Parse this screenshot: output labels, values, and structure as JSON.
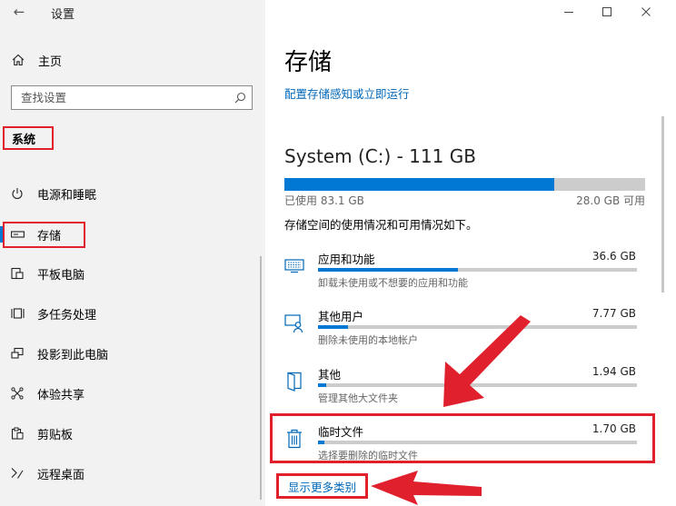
{
  "window": {
    "app_title": "设置",
    "back_icon": "back-arrow-icon",
    "controls": [
      "minimize-icon",
      "maximize-icon",
      "close-icon"
    ]
  },
  "sidebar": {
    "home": {
      "label": "主页",
      "icon": "home-icon"
    },
    "search": {
      "placeholder": "查找设置",
      "icon": "search-icon"
    },
    "section_title": "系统",
    "items": [
      {
        "label": "电源和睡眠",
        "icon": "power-icon",
        "selected": false
      },
      {
        "label": "存储",
        "icon": "storage-icon",
        "selected": true
      },
      {
        "label": "平板电脑",
        "icon": "tablet-icon",
        "selected": false
      },
      {
        "label": "多任务处理",
        "icon": "multitasking-icon",
        "selected": false
      },
      {
        "label": "投影到此电脑",
        "icon": "project-icon",
        "selected": false
      },
      {
        "label": "体验共享",
        "icon": "shared-experience-icon",
        "selected": false
      },
      {
        "label": "剪贴板",
        "icon": "clipboard-icon",
        "selected": false
      },
      {
        "label": "远程桌面",
        "icon": "remote-desktop-icon",
        "selected": false
      }
    ]
  },
  "main": {
    "title": "存储",
    "storage_sense_link": "配置存储感知或立即运行",
    "drive": {
      "title": "System (C:) - 111 GB",
      "used_label": "已使用 83.1 GB",
      "free_label": "28.0 GB 可用",
      "used_fraction": 0.748
    },
    "usage_description": "存储空间的使用情况和可用情况如下。",
    "categories": [
      {
        "name": "应用和功能",
        "size": "36.6 GB",
        "description": "卸载未使用或不想要的应用和功能",
        "fraction": 0.44,
        "icon": "apps-icon"
      },
      {
        "name": "其他用户",
        "size": "7.77 GB",
        "description": "删除未使用的本地帐户",
        "fraction": 0.095,
        "icon": "other-users-icon"
      },
      {
        "name": "其他",
        "size": "1.94 GB",
        "description": "管理其他大文件夹",
        "fraction": 0.025,
        "icon": "folder-icon"
      },
      {
        "name": "临时文件",
        "size": "1.70 GB",
        "description": "选择要删除的临时文件",
        "fraction": 0.02,
        "icon": "trash-icon"
      }
    ],
    "show_more_link": "显示更多类别"
  },
  "colors": {
    "accent": "#0078d4",
    "link": "#0067b8",
    "highlight_red": "#e0212d",
    "sidebar_bg": "#f2f2f2"
  }
}
